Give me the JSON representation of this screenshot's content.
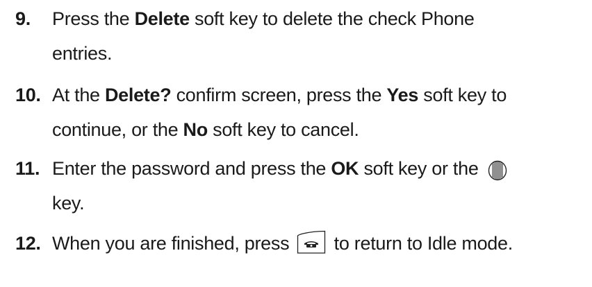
{
  "steps": [
    {
      "number": "9.",
      "lines": [
        {
          "a": "Press the ",
          "b": "Delete",
          "c": " soft key to delete the check Phone"
        },
        {
          "a": "entries."
        }
      ]
    },
    {
      "number": "10.",
      "lines": [
        {
          "a": "At the ",
          "b": "Delete?",
          "c": " confirm screen, press the ",
          "d": "Yes",
          "e": " soft key to"
        },
        {
          "a": "continue, or the ",
          "b": "No",
          "c": " soft key to cancel."
        }
      ]
    },
    {
      "number": "11.",
      "lines": [
        {
          "a": "Enter the password and press the ",
          "b": "OK",
          "c": " soft key or the "
        },
        {
          "a": "key."
        }
      ],
      "icon": "navigation-center-key-icon"
    },
    {
      "number": "12.",
      "lines": [
        {
          "a": "When you are finished, press ",
          "c": " to return to Idle mode."
        }
      ],
      "icon": "end-key-icon"
    }
  ],
  "colors": {
    "text": "#1a1a1a",
    "icon_stroke": "#222222"
  }
}
